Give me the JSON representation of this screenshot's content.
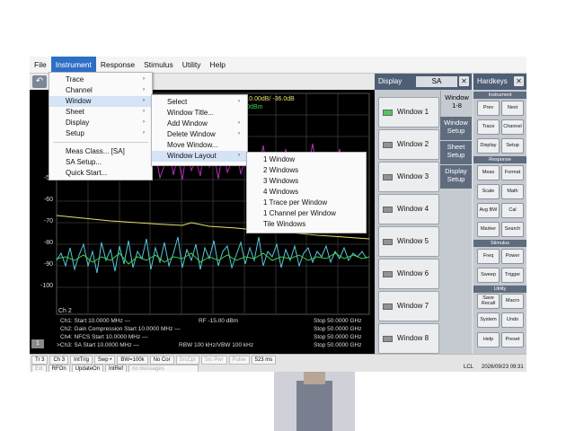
{
  "menubar": [
    "File",
    "Instrument",
    "Response",
    "Stimulus",
    "Utility",
    "Help"
  ],
  "instrument_menu": {
    "items": [
      "Trace",
      "Channel",
      "Window",
      "Sheet",
      "Display",
      "Setup",
      "Meas Class... [SA]",
      "SA Setup...",
      "Quick Start..."
    ]
  },
  "window_menu": {
    "items": [
      "Select",
      "Window Title...",
      "Add Window",
      "Delete Window",
      "Move Window...",
      "Window Layout"
    ]
  },
  "window_layout_menu": {
    "items": [
      "1 Window",
      "2 Windows",
      "3 Windows",
      "4 Windows",
      "1 Trace per Window",
      "1 Channel per Window",
      "Tile Windows"
    ]
  },
  "plot": {
    "header_line1": "B/ -46.12dB LogM 10.00dB/ -36.0dB",
    "header_line2": "LogM 10.00dB/ 0.00dBm",
    "y_ticks": [
      "-50",
      "-60",
      "-70",
      "-80",
      "-90",
      "-100"
    ],
    "channel_label": "Ch 2",
    "window_number": "1",
    "legend": [
      {
        "left": "Ch1: Start  10.0000 MHz —",
        "mid": "RF -15.00 dBm",
        "right": "Stop 50.0000 GHz"
      },
      {
        "left": "Ch2: Gain Compression  Start  10.0000 MHz —",
        "mid": "",
        "right": "Stop 50.0000 GHz"
      },
      {
        "left": "Ch4: NFCS  Start  10.0000 MHz —",
        "mid": "",
        "right": "Stop 50.0000 GHz"
      },
      {
        "left": ">Ch3: SA  Start  10.0000 MHz —",
        "mid": "RBW 100 kHz/VBW 100 kHz",
        "right": "Stop 50.0000 GHz"
      }
    ],
    "colors": {
      "yellow": "#e9e26a",
      "cyan": "#58c6d8",
      "green": "#3ed24a",
      "magenta": "#b62fb8"
    }
  },
  "display_panel": {
    "title": "Display",
    "mode": "SA",
    "windows": [
      "Window 1",
      "Window 2",
      "Window 3",
      "Window 4",
      "Window 5",
      "Window 6",
      "Window 7",
      "Window 8"
    ],
    "tabs": [
      "Window 1-8",
      "Window Setup",
      "Sheet Setup",
      "Display Setup"
    ]
  },
  "hardkeys": {
    "title": "Hardkeys",
    "sections": {
      "instrument": "Instrument",
      "response": "Response",
      "stimulus": "Stimulus",
      "utility": "Utility"
    },
    "keys": {
      "prev": "Prev",
      "next": "Next",
      "trace": "Trace",
      "channel": "Channel",
      "display": "Display",
      "setup": "Setup",
      "meas": "Meas",
      "format": "Format",
      "scale": "Scale",
      "math": "Math",
      "avgbw": "Avg BW",
      "cal": "Cal",
      "marker": "Marker",
      "search": "Search",
      "freq": "Freq",
      "power": "Power",
      "sweep": "Sweep",
      "trigger": "Trigger",
      "save_recall_1": "Save",
      "save_recall_2": "Recall",
      "macro": "Macro",
      "system": "System",
      "undo": "Undo",
      "help": "Help",
      "preset": "Preset"
    }
  },
  "status": {
    "row1": [
      "Tr 3",
      "Ch 3",
      "IntTrig",
      "Swp •",
      "BW=100k",
      "No Cor",
      "SrcCpl",
      "Src Pwr",
      "Pulse",
      "523 ms"
    ],
    "row2": [
      "Ext",
      "RFOn",
      "UpdateOn",
      "IntRef",
      "no messages"
    ],
    "lcl": "LCL",
    "time": "2026/09/23 09:31"
  }
}
